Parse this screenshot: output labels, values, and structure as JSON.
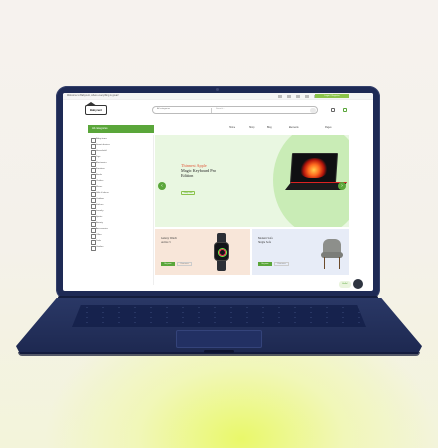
{
  "screen": {
    "topbar": {
      "welcome": "Welcome to Babyrent, where everything is great!",
      "login_button": "Login / Register"
    },
    "logo": "Babyrent",
    "search": {
      "category": "All categories",
      "placeholder": "Search…"
    },
    "all_categories": "All categories",
    "nav": [
      "Home",
      "Shop",
      "Blog",
      "Elements",
      "Pages"
    ],
    "sidebar": [
      "Baby items",
      "Smart devices",
      "Household",
      "Toys",
      "Electronics",
      "Furniture",
      "Books",
      "Clothes",
      "Shoes",
      "Gifts & decor",
      "Outdoor",
      "Kitchen",
      "Jewelry",
      "Sports",
      "Beauty",
      "Accessories",
      "Office",
      "Tools",
      "Garden"
    ],
    "hero": {
      "kicker": "Thinnest Apple",
      "title_lines": [
        "Magic Keyboard Pro",
        "Edition"
      ],
      "cta": "Shop now",
      "prev": "‹",
      "next": "›"
    },
    "promo_cards": [
      {
        "title_lines": [
          "Galaxy Watch",
          "Active 3"
        ],
        "button": "Buy now",
        "link": "View more"
      },
      {
        "title_lines": [
          "Modern Sofa",
          "Single Sofa"
        ],
        "button": "Buy now",
        "link": "View more"
      }
    ],
    "chat_label": "Hello!"
  },
  "colors": {
    "brand_green": "#5aa63a",
    "laptop_body": "#1e2a55",
    "hero_bg": "#e9f7e1"
  }
}
